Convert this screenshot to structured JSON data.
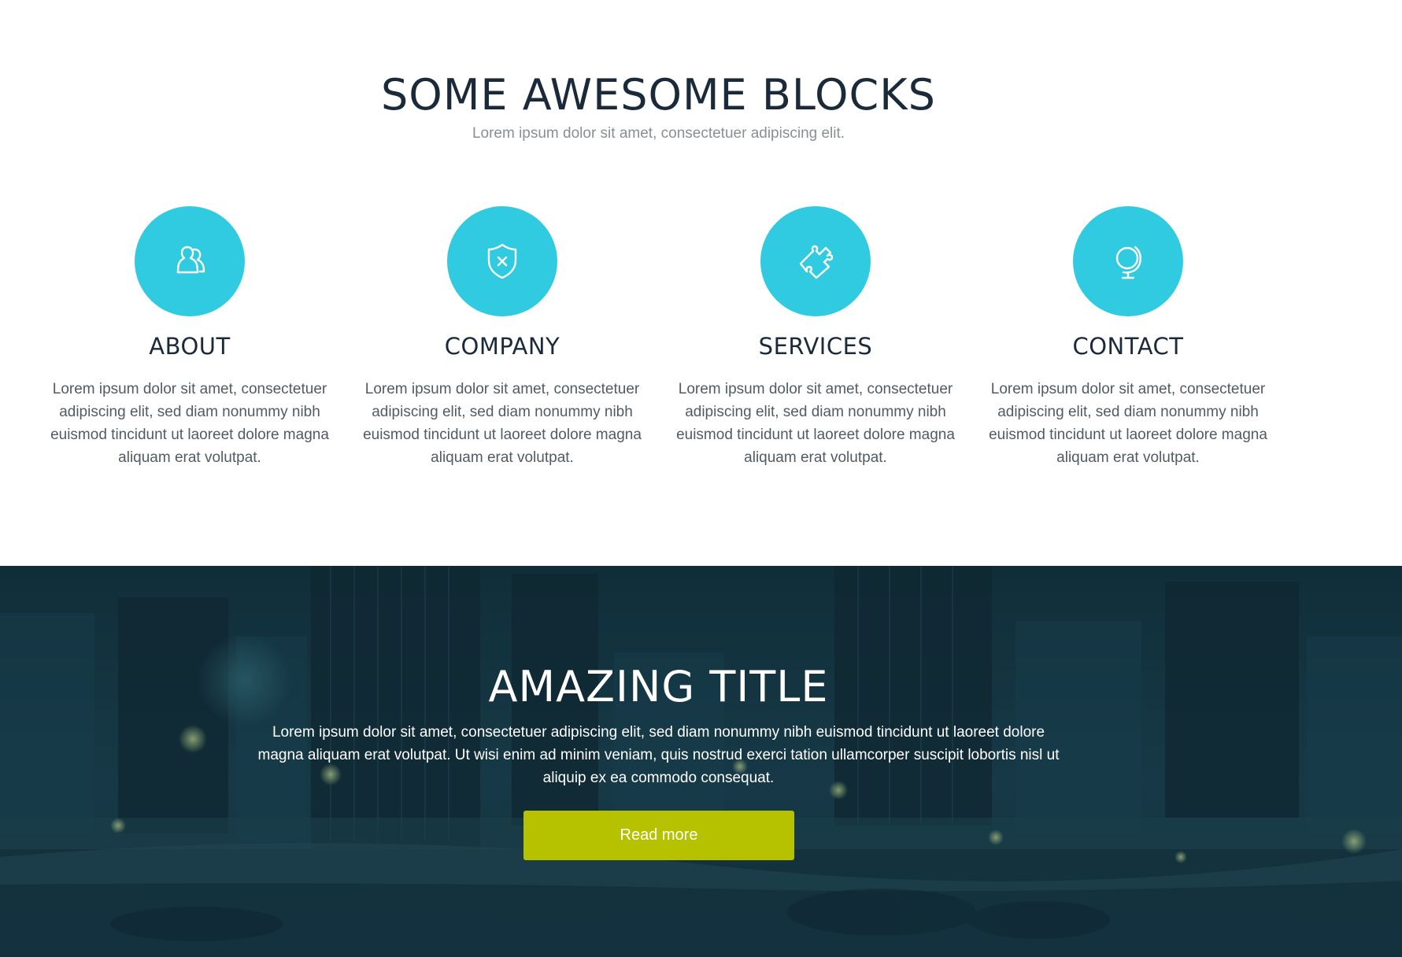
{
  "blocks_section": {
    "title": "SOME AWESOME BLOCKS",
    "subtitle": "Lorem ipsum dolor sit amet, consectetuer adipiscing elit.",
    "accent_color": "#30cbe1",
    "items": [
      {
        "icon": "users-icon",
        "title": "ABOUT",
        "text": "Lorem ipsum dolor sit amet, consectetuer adipiscing elit, sed diam nonummy nibh euismod tincidunt ut laoreet dolore magna aliquam erat volutpat."
      },
      {
        "icon": "shield-icon",
        "title": "COMPANY",
        "text": "Lorem ipsum dolor sit amet, consectetuer adipiscing elit, sed diam nonummy nibh euismod tincidunt ut laoreet dolore magna aliquam erat volutpat."
      },
      {
        "icon": "puzzle-icon",
        "title": "SERVICES",
        "text": "Lorem ipsum dolor sit amet, consectetuer adipiscing elit, sed diam nonummy nibh euismod tincidunt ut laoreet dolore magna aliquam erat volutpat."
      },
      {
        "icon": "globe-icon",
        "title": "CONTACT",
        "text": "Lorem ipsum dolor sit amet, consectetuer adipiscing elit, sed diam nonummy nibh euismod tincidunt ut laoreet dolore magna aliquam erat volutpat."
      }
    ]
  },
  "hero": {
    "title": "AMAZING TITLE",
    "text": "Lorem ipsum dolor sit amet, consectetuer adipiscing elit, sed diam nonummy nibh euismod tincidunt ut laoreet dolore magna aliquam erat volutpat. Ut wisi enim ad minim veniam, quis nostrud exerci tation ullamcorper suscipit lobortis nisl ut aliquip ex ea commodo consequat.",
    "button_label": "Read more",
    "button_color": "#b6c200",
    "overlay_color": "#16303c"
  }
}
